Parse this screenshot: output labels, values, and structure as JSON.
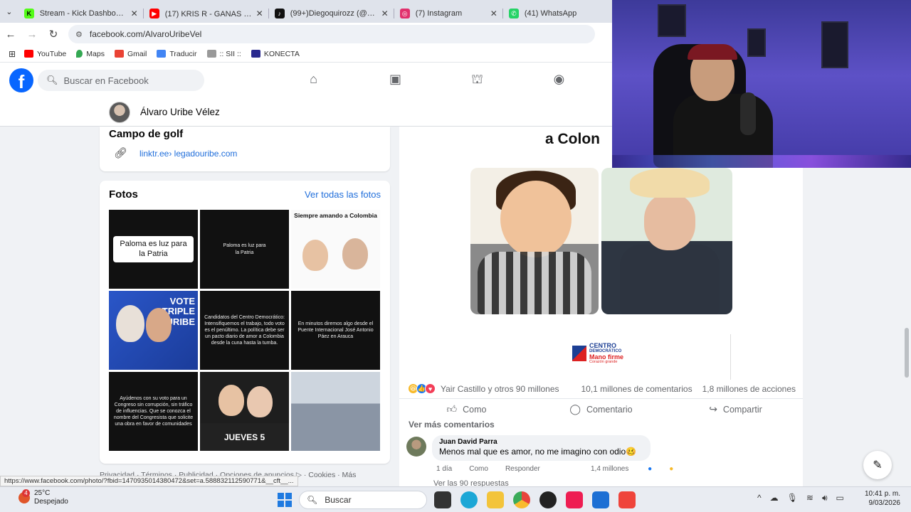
{
  "browser": {
    "tabs": [
      {
        "title": "Stream - Kick Dashboard",
        "favicon_color": "#53fc18",
        "favicon_icon": "kick-icon"
      },
      {
        "title": "(17) KRIS R - GANAS 💗 (Vi",
        "favicon_color": "#ff0000",
        "favicon_icon": "youtube-icon"
      },
      {
        "title": "(99+)Diegoquirozz (@dieg",
        "favicon_color": "#111111",
        "favicon_icon": "tiktok-icon"
      },
      {
        "title": "(7) Instagram",
        "favicon_color": "#e1306c",
        "favicon_icon": "instagram-icon"
      },
      {
        "title": "(41) WhatsApp",
        "favicon_color": "#25d366",
        "favicon_icon": "whatsapp-icon"
      }
    ],
    "url": "facebook.com/AlvaroUribeVel",
    "bookmarks": [
      {
        "label": "YouTube",
        "color": "#ff0000"
      },
      {
        "label": "Maps",
        "color": "#34a853"
      },
      {
        "label": "Gmail",
        "color": "#ea4335"
      },
      {
        "label": "Traducir",
        "color": "#4285f4"
      },
      {
        "label": ":: SII ::",
        "color": "#777777"
      },
      {
        "label": "KONECTA",
        "color": "#2a2a8f"
      }
    ],
    "status_url": "https://www.facebook.com/photo/?fbid=1470935014380472&set=a.588832112590771&__cft__..."
  },
  "facebook": {
    "search_placeholder": "Buscar en Facebook",
    "profile_name": "Álvaro Uribe Vélez",
    "info_card": {
      "category": "Campo de golf",
      "link": "linktr.ee› legadouribe.com"
    },
    "photos_card": {
      "title": "Fotos",
      "see_all": "Ver todas las fotos",
      "photos": [
        {
          "kind": "pill",
          "text": "Paloma es luz para la Patria"
        },
        {
          "kind": "dark",
          "text": "Paloma es luz para la Patria"
        },
        {
          "kind": "illustration",
          "text": "Siempre amando a Colombia"
        },
        {
          "kind": "blue",
          "text": "VOTE TRIPLE URIBE"
        },
        {
          "kind": "dark",
          "text": "Candidatos del Centro Democrático: Intensifiquemos el trabajo, todo voto es el penúltimo. La política debe ser un pacto diario de amor a Colombia desde la cuna hasta la tumba."
        },
        {
          "kind": "dark",
          "text": "En minutos diremos algo desde el Puente Internacional José Antonio Páez en Arauca"
        },
        {
          "kind": "dark",
          "text": "Ayúdenos con su voto para un Congreso sin corrupción, sin tráfico de influencias. Que se conozca el nombre del Congresista que solicite una obra en favor de comunidades"
        },
        {
          "kind": "conv",
          "text": "JUEVES 5"
        },
        {
          "kind": "crowd",
          "text": ""
        }
      ]
    },
    "footer": "Privacidad · Términos · Publicidad · Opciones de anuncios ▷ · Cookies · Más",
    "post": {
      "headline": "a Colon",
      "logo_line1": "CENTRO",
      "logo_line2": "DEMOCRÁTICO",
      "logo_line3": "Mano firme",
      "logo_line4": "Corazón grande",
      "reactions_by": "Yair Castillo y otros 90 millones",
      "comments_count": "10,1 millones de comentarios",
      "shares_count": "1,8 millones de acciones",
      "action_like": "Como",
      "action_comment": "Comentario",
      "action_share": "Compartir",
      "more_comments": "Ver más comentarios",
      "comment": {
        "author": "Juan David Parra",
        "text": "Menos mal que es amor, no me imagino con odio🥴",
        "age": "1 día",
        "like": "Como",
        "reply": "Responder",
        "likes": "1,4 millones"
      },
      "replies": "Ver las 90 respuestas"
    }
  },
  "taskbar": {
    "weather_temp": "25°C",
    "weather_desc": "Despejado",
    "weather_badge": "4",
    "search_label": "Buscar",
    "time": "10:41 p. m.",
    "date": "9/03/2026",
    "apps": [
      {
        "name": "task-view-icon",
        "color": "#333333"
      },
      {
        "name": "edge-icon",
        "color": "#1ca7d6"
      },
      {
        "name": "file-explorer-icon",
        "color": "#f3c43a"
      },
      {
        "name": "chrome-icon",
        "color": "#e8453c"
      },
      {
        "name": "obs-icon",
        "color": "#222222"
      },
      {
        "name": "tiktok-live-icon",
        "color": "#ee1d52"
      },
      {
        "name": "store-icon",
        "color": "#1c6fd4"
      },
      {
        "name": "anydesk-icon",
        "color": "#ef443b"
      }
    ]
  }
}
